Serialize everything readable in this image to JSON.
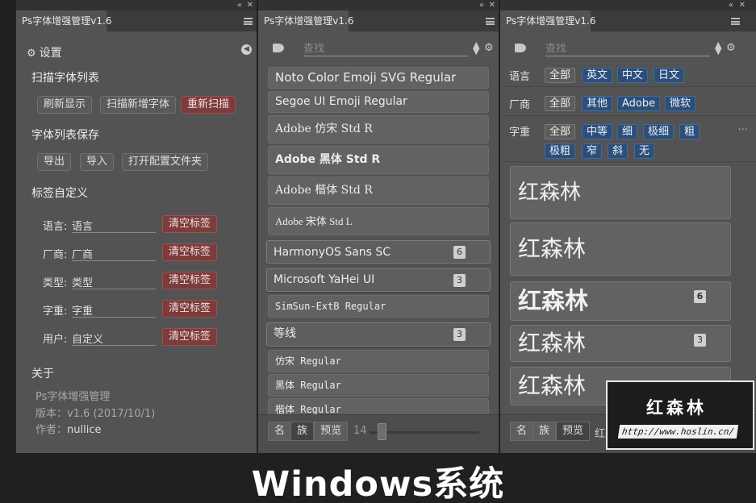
{
  "panel_title": "Ps字体增强管理v1.6",
  "settings": {
    "heading": "设置",
    "scan_title": "扫描字体列表",
    "scan_buttons": [
      "刷新显示",
      "扫描新增字体",
      "重新扫描"
    ],
    "save_title": "字体列表保存",
    "save_buttons": [
      "导出",
      "导入",
      "打开配置文件夹"
    ],
    "tags_title": "标签自定义",
    "tag_rows": [
      {
        "label": "语言:",
        "value": "语言"
      },
      {
        "label": "厂商:",
        "value": "厂商"
      },
      {
        "label": "类型:",
        "value": "类型"
      },
      {
        "label": "字重:",
        "value": "字重"
      },
      {
        "label": "用户:",
        "value": "自定义"
      }
    ],
    "clear_tag_label": "清空标签",
    "about_title": "关于",
    "about_name": "Ps字体增强管理",
    "about_version_label": "版本：",
    "about_version": "v1.6 (2017/10/1)",
    "about_author_label": "作者：",
    "about_author": "nullice"
  },
  "search_placeholder": "查找",
  "font_list": [
    {
      "name": "Noto Color Emoji SVG Regular"
    },
    {
      "name": "Segoe UI Emoji Regular"
    },
    {
      "name": "Adobe 仿宋 Std R"
    },
    {
      "name": "Adobe 黑体 Std R"
    },
    {
      "name": "Adobe 楷体 Std R"
    },
    {
      "name": "Adobe 宋体 Std L"
    },
    {
      "name": "HarmonyOS Sans SC",
      "count": "6"
    },
    {
      "name": "Microsoft YaHei UI",
      "count": "3"
    },
    {
      "name": "SimSun-ExtB Regular"
    },
    {
      "name": "等线",
      "count": "3"
    },
    {
      "name": "仿宋 Regular"
    },
    {
      "name": "黑体 Regular"
    },
    {
      "name": "楷体 Regular"
    }
  ],
  "bottom_tabs": [
    "名",
    "族",
    "预览"
  ],
  "font_size": "14",
  "filters": {
    "language_label": "语言",
    "language": [
      "全部",
      "英文",
      "中文",
      "日文"
    ],
    "vendor_label": "厂商",
    "vendor": [
      "全部",
      "其他",
      "Adobe",
      "微软"
    ],
    "weight_label": "字重",
    "weight": [
      "全部",
      "中等",
      "细",
      "极细",
      "粗",
      "极粗",
      "窄",
      "斜",
      "无"
    ],
    "more": "···"
  },
  "preview_text": "红森林",
  "preview_counts": [
    "6",
    "3"
  ],
  "preview_bottom_partial": "红森",
  "watermark": {
    "title": "红森林",
    "url": "http://www.hoslin.cn/"
  },
  "caption": "Windows系统",
  "colors": {
    "panel": "#535353",
    "chip_blue": "#2c4f7a",
    "clear_red": "#7c3c3c",
    "background": "#202020"
  }
}
